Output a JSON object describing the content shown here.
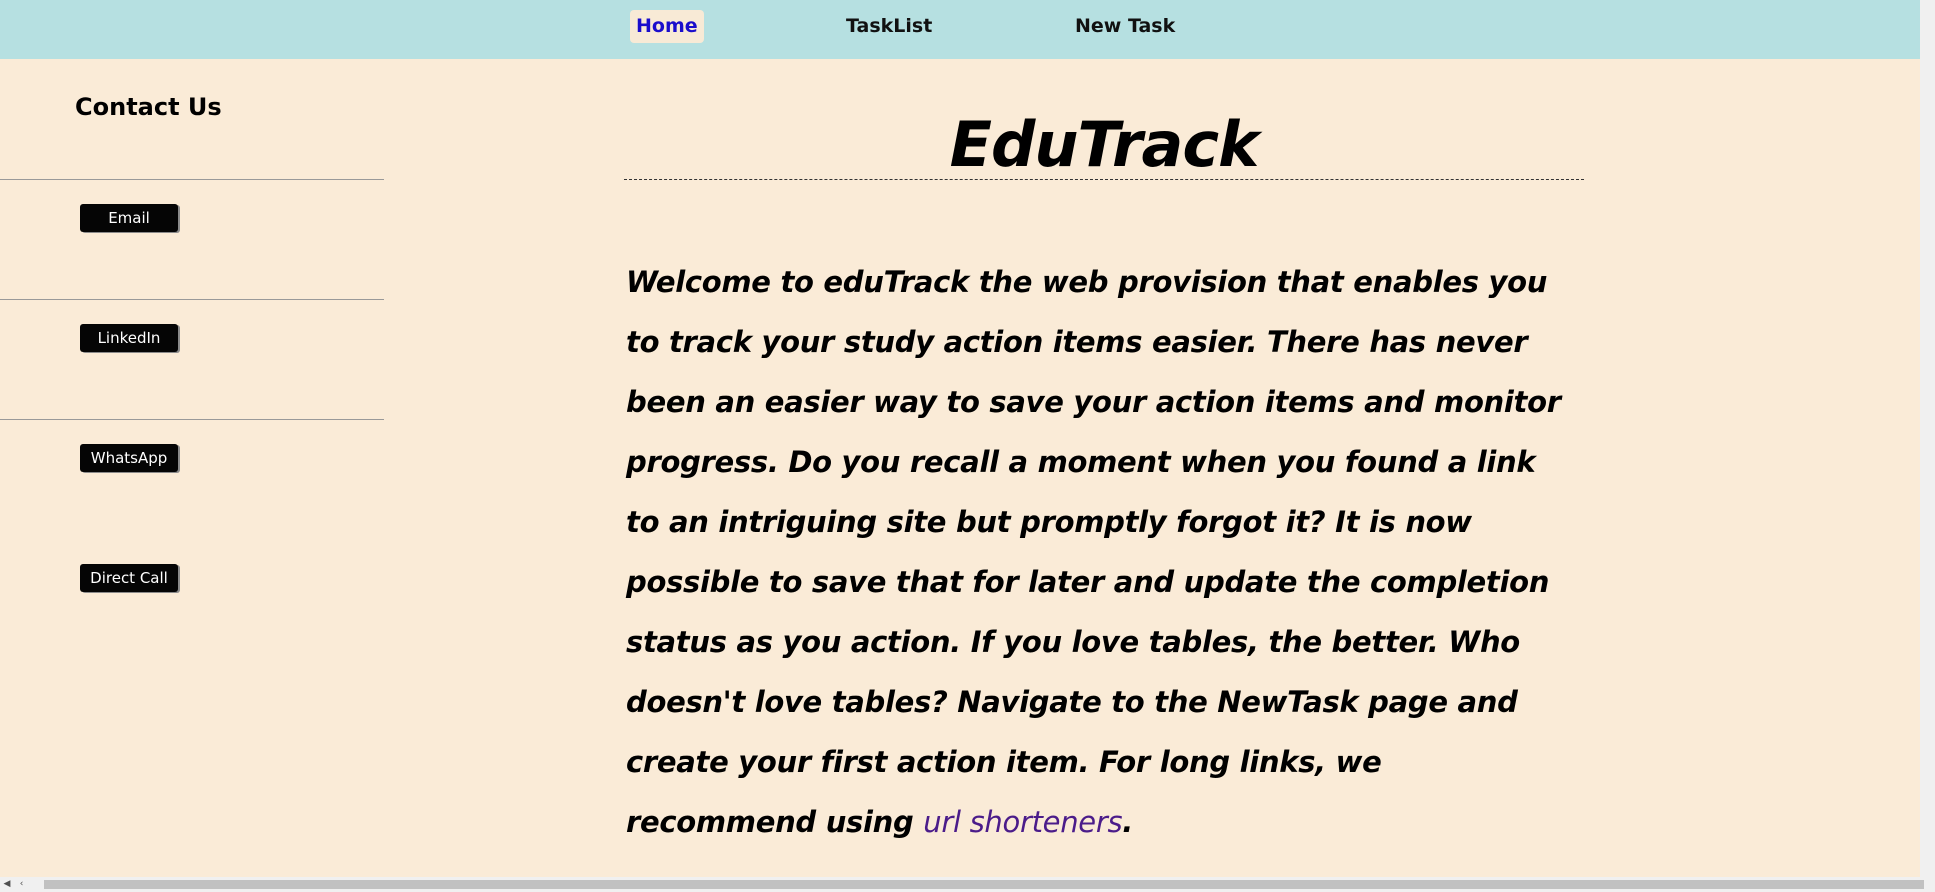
{
  "nav": {
    "items": [
      {
        "label": "Home",
        "active": true
      },
      {
        "label": "TaskList",
        "active": false
      },
      {
        "label": "New Task",
        "active": false
      }
    ]
  },
  "sidebar": {
    "title": "Contact Us",
    "buttons": [
      {
        "label": "Email"
      },
      {
        "label": "LinkedIn"
      },
      {
        "label": "WhatsApp"
      },
      {
        "label": "Direct Call"
      }
    ]
  },
  "main": {
    "title": "EduTrack",
    "welcome_text": "Welcome to eduTrack the web provision that enables you to track your study action items easier. There has never been an easier way to save your action items and monitor progress. Do you recall a moment when you found a link to an intriguing site but promptly forgot it? It is now possible to save that for later and update the completion status as you action. If you love tables, the better. Who doesn't love tables? Navigate to the NewTask page and create your first action item. For long links, we recommend using ",
    "link_text": "url shorteners",
    "trailing": "."
  },
  "colors": {
    "nav_bg": "#b6e0e1",
    "page_bg": "#faebd7",
    "active_link": "#1a0dcc",
    "link": "#4b1c8a",
    "button_bg": "#050505"
  },
  "icons": {
    "scroll_left": "chevron-left-icon"
  }
}
